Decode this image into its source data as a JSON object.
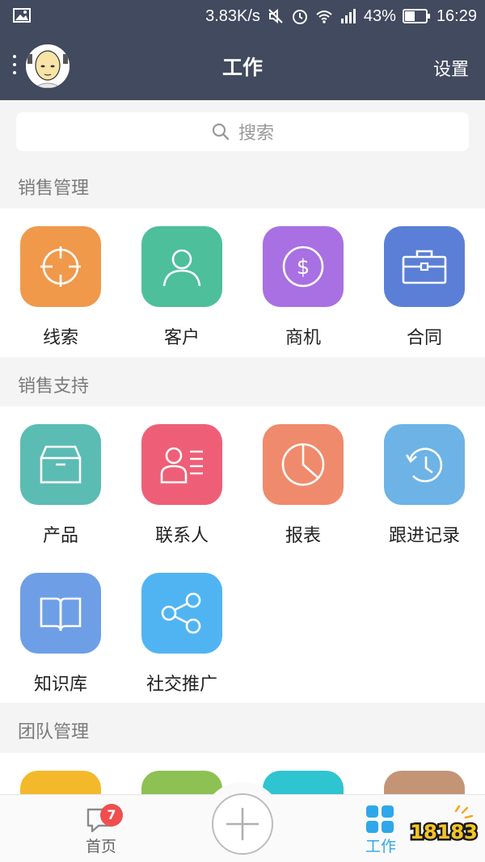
{
  "status_bar": {
    "speed": "3.83K/s",
    "battery": "43%",
    "time": "16:29"
  },
  "header": {
    "title": "工作",
    "settings_label": "设置"
  },
  "search": {
    "placeholder": "搜索"
  },
  "sections": {
    "sales_management": {
      "label": "销售管理",
      "items": [
        {
          "label": "线索",
          "icon": "crosshair-icon",
          "color": "#f0994b"
        },
        {
          "label": "客户",
          "icon": "person-icon",
          "color": "#4dbf9a"
        },
        {
          "label": "商机",
          "icon": "dollar-coin-icon",
          "color": "#a870e2"
        },
        {
          "label": "合同",
          "icon": "briefcase-icon",
          "color": "#5b7fd6"
        }
      ]
    },
    "sales_support": {
      "label": "销售支持",
      "items": [
        {
          "label": "产品",
          "icon": "box-icon",
          "color": "#5bbcb4"
        },
        {
          "label": "联系人",
          "icon": "contact-card-icon",
          "color": "#ee5f77"
        },
        {
          "label": "报表",
          "icon": "pie-chart-icon",
          "color": "#f08a6c"
        },
        {
          "label": "跟进记录",
          "icon": "history-clock-icon",
          "color": "#6db3e6"
        },
        {
          "label": "知识库",
          "icon": "book-icon",
          "color": "#6e9fe6"
        },
        {
          "label": "社交推广",
          "icon": "share-icon",
          "color": "#51b4f2"
        }
      ]
    },
    "team_management": {
      "label": "团队管理",
      "items": [
        {
          "icon": "team-item-1-icon",
          "color": "#f3b92a"
        },
        {
          "icon": "team-item-2-icon",
          "color": "#8dc153"
        },
        {
          "icon": "team-item-3-icon",
          "color": "#2ec4d0"
        },
        {
          "icon": "team-item-4-icon",
          "color": "#c49476"
        }
      ]
    }
  },
  "bottom_nav": {
    "home_label": "首页",
    "home_badge": "7",
    "work_label": "工作",
    "active_color": "#2ea8ea",
    "watermark": "18183"
  },
  "colors": {
    "header_bg": "#414a5e",
    "page_bg": "#f4f4f4"
  }
}
